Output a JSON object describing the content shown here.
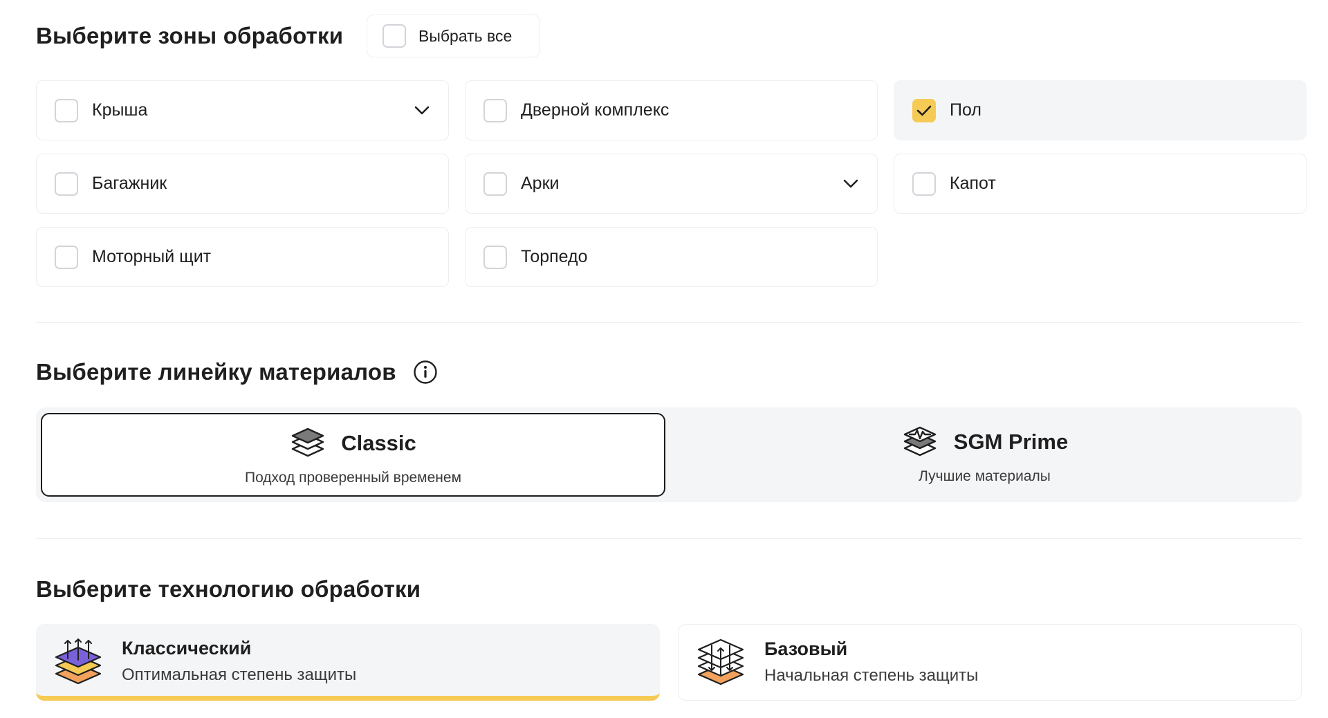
{
  "zones": {
    "title": "Выберите зоны обработки",
    "select_all_label": "Выбрать все",
    "items": [
      {
        "label": "Крыша",
        "checked": false,
        "expandable": true
      },
      {
        "label": "Дверной комплекс",
        "checked": false,
        "expandable": false
      },
      {
        "label": "Пол",
        "checked": true,
        "expandable": false
      },
      {
        "label": "Багажник",
        "checked": false,
        "expandable": false
      },
      {
        "label": "Арки",
        "checked": false,
        "expandable": true
      },
      {
        "label": "Капот",
        "checked": false,
        "expandable": false
      },
      {
        "label": "Моторный щит",
        "checked": false,
        "expandable": false
      },
      {
        "label": "Торпедо",
        "checked": false,
        "expandable": false
      }
    ]
  },
  "materials": {
    "title": "Выберите линейку материалов",
    "options": [
      {
        "name": "Classic",
        "subtitle": "Подход проверенный временем",
        "selected": true,
        "icon": "layers-stack-icon"
      },
      {
        "name": "SGM Prime",
        "subtitle": "Лучшие материалы",
        "selected": false,
        "icon": "layers-pulse-icon"
      }
    ]
  },
  "technology": {
    "title": "Выберите технологию обработки",
    "options": [
      {
        "name": "Классический",
        "subtitle": "Оптимальная степень защиты",
        "selected": true,
        "icon": "layers-classic-icon"
      },
      {
        "name": "Базовый",
        "subtitle": "Начальная степень защиты",
        "selected": false,
        "icon": "layers-basic-icon"
      }
    ]
  },
  "colors": {
    "accent": "#F6CB55",
    "selected_bg": "#F4F5F7",
    "border": "#ECEEF1",
    "text": "#1F1F1F",
    "icon_purple": "#7B61D9",
    "icon_orange": "#F2A25C"
  }
}
